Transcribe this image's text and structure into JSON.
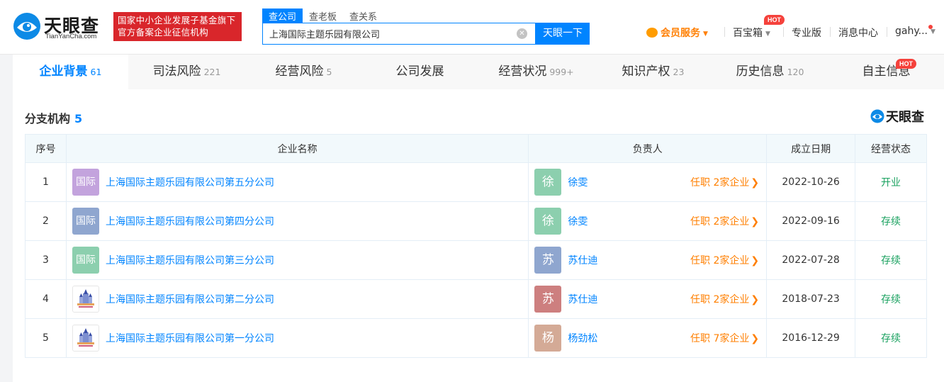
{
  "header": {
    "logo_text": "天眼查",
    "logo_sub": "TianYanCha.com",
    "banner_line1": "国家中小企业发展子基金旗下",
    "banner_line2": "官方备案企业征信机构",
    "search_tabs": [
      "查公司",
      "查老板",
      "查关系"
    ],
    "search_value": "上海国际主题乐园有限公司",
    "search_button": "天眼一下",
    "vip_label": "会员服务",
    "baibaoxiang": "百宝箱",
    "hot_label": "HOT",
    "pro_label": "专业版",
    "messages_label": "消息中心",
    "user_label": "gahy...",
    "colors": {
      "accent": "#0084ff",
      "banner": "#d9262b",
      "vip": "#ff7f00"
    }
  },
  "tabs": [
    {
      "label": "企业背景",
      "count": "61"
    },
    {
      "label": "司法风险",
      "count": "221"
    },
    {
      "label": "经营风险",
      "count": "5"
    },
    {
      "label": "公司发展",
      "count": ""
    },
    {
      "label": "经营状况",
      "count": "999+"
    },
    {
      "label": "知识产权",
      "count": "23"
    },
    {
      "label": "历史信息",
      "count": "120"
    },
    {
      "label": "自主信息",
      "count": "",
      "badge": "HOT"
    }
  ],
  "section": {
    "title": "分支机构",
    "count": "5",
    "watermark": "天眼查"
  },
  "table": {
    "headers": [
      "序号",
      "企业名称",
      "负责人",
      "成立日期",
      "经营状态"
    ],
    "rows": [
      {
        "index": "1",
        "logo_text": "国际",
        "logo_color": "#c3a3dd",
        "name": "上海国际主题乐园有限公司第五分公司",
        "person_avatar": "徐",
        "avatar_color": "#8ccfae",
        "person": "徐雯",
        "link": "任职 2家企业",
        "date": "2022-10-26",
        "status": "开业"
      },
      {
        "index": "2",
        "logo_text": "国际",
        "logo_color": "#8fa6cf",
        "name": "上海国际主题乐园有限公司第四分公司",
        "person_avatar": "徐",
        "avatar_color": "#8ccfae",
        "person": "徐雯",
        "link": "任职 2家企业",
        "date": "2022-09-16",
        "status": "存续"
      },
      {
        "index": "3",
        "logo_text": "国际",
        "logo_color": "#8ccfae",
        "name": "上海国际主题乐园有限公司第三分公司",
        "person_avatar": "苏",
        "avatar_color": "#8fa6cf",
        "person": "苏仕迪",
        "link": "任职 2家企业",
        "date": "2022-07-28",
        "status": "存续"
      },
      {
        "index": "4",
        "logo_text": "",
        "logo_color": "",
        "name": "上海国际主题乐园有限公司第二分公司",
        "person_avatar": "苏",
        "avatar_color": "#cd7f7f",
        "person": "苏仕迪",
        "link": "任职 2家企业",
        "date": "2018-07-23",
        "status": "存续"
      },
      {
        "index": "5",
        "logo_text": "",
        "logo_color": "",
        "name": "上海国际主题乐园有限公司第一分公司",
        "person_avatar": "杨",
        "avatar_color": "#d4aa96",
        "person": "杨劲松",
        "link": "任职 7家企业",
        "date": "2016-12-29",
        "status": "存续"
      }
    ]
  }
}
